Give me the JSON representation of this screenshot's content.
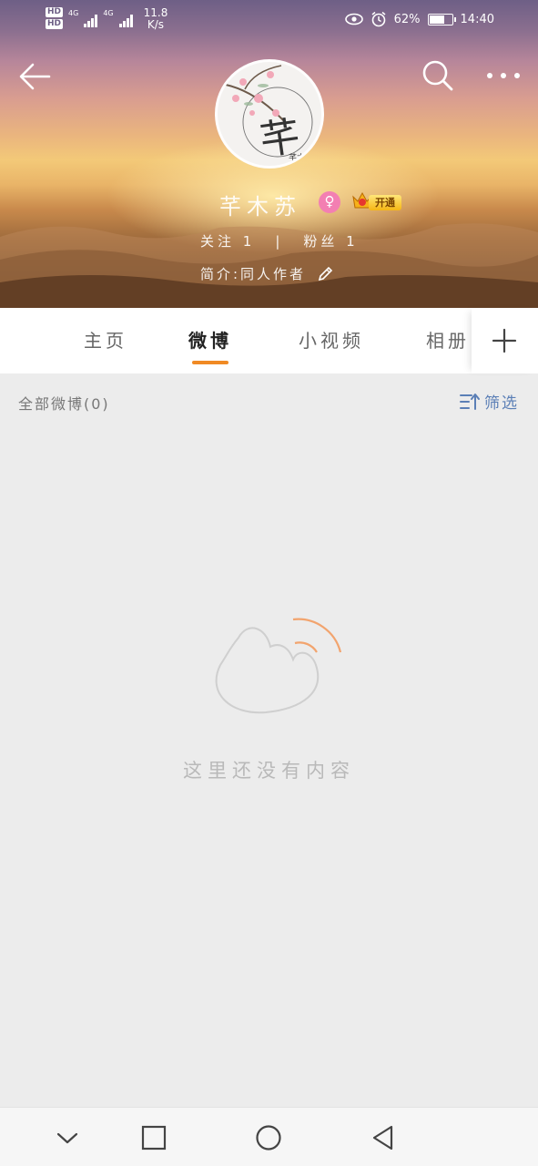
{
  "status_bar": {
    "sim1": "HD",
    "sim2": "HD",
    "net1": "4G",
    "net2": "4G",
    "speed_value": "11.8",
    "speed_unit": "K/s",
    "battery_percent": "62%",
    "battery_level": 0.62,
    "time": "14:40",
    "icons": [
      "eye-icon",
      "alarm-icon",
      "battery-icon"
    ]
  },
  "header": {
    "back_icon": "arrow-left-icon",
    "search_icon": "search-icon",
    "more_icon": "more-icon",
    "avatar_text": "芊",
    "avatar_small_text": "芊木"
  },
  "profile": {
    "username": "芊木苏",
    "gender_icon": "female-icon",
    "vip_label": "开通",
    "following": "关注 1",
    "followers": "粉丝 1",
    "divider": "|",
    "bio": "简介:同人作者",
    "edit_icon": "pencil-icon"
  },
  "tabs": [
    {
      "label": "主页",
      "active": false
    },
    {
      "label": "微博",
      "active": true
    },
    {
      "label": "小视频",
      "active": false
    },
    {
      "label": "相册",
      "active": false
    }
  ],
  "tab_add_icon": "plus-icon",
  "feed": {
    "all_posts_label": "全部微博(0)",
    "filter_label": "筛选",
    "filter_icon": "filter-sort-icon",
    "empty_text": "这里还没有内容"
  },
  "colors": {
    "accent": "#f08a24",
    "link": "#5b7fb6",
    "background": "#ececec"
  },
  "navbar": [
    "collapse-icon",
    "recents-icon",
    "home-icon",
    "back-icon"
  ]
}
